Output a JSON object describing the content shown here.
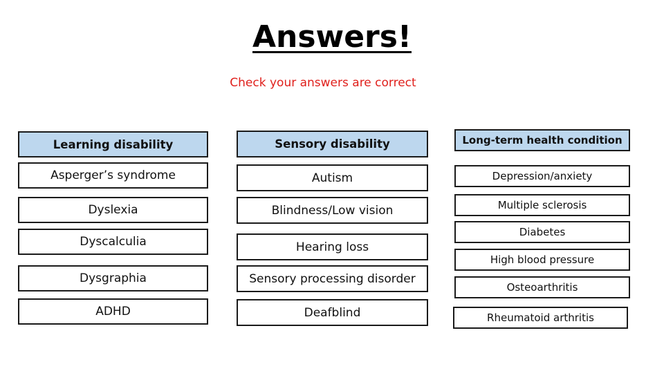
{
  "title": "Answers!",
  "subtitle": "Check your answers are correct",
  "columns": [
    {
      "header": "Learning disability",
      "items": [
        "Asperger’s syndrome",
        "Dyslexia",
        "Dyscalculia",
        "Dysgraphia",
        "ADHD"
      ]
    },
    {
      "header": "Sensory disability",
      "items": [
        "Autism",
        "Blindness/Low vision",
        "Hearing loss",
        "Sensory processing disorder",
        "Deafblind"
      ]
    },
    {
      "header": "Long-term health condition",
      "items": [
        "Depression/anxiety",
        "Multiple sclerosis",
        "Diabetes",
        "High blood pressure",
        "Osteoarthritis",
        "Rheumatoid arthritis"
      ]
    }
  ],
  "colors": {
    "header_fill": "#bdd7ee",
    "subtitle": "#e0201c"
  }
}
